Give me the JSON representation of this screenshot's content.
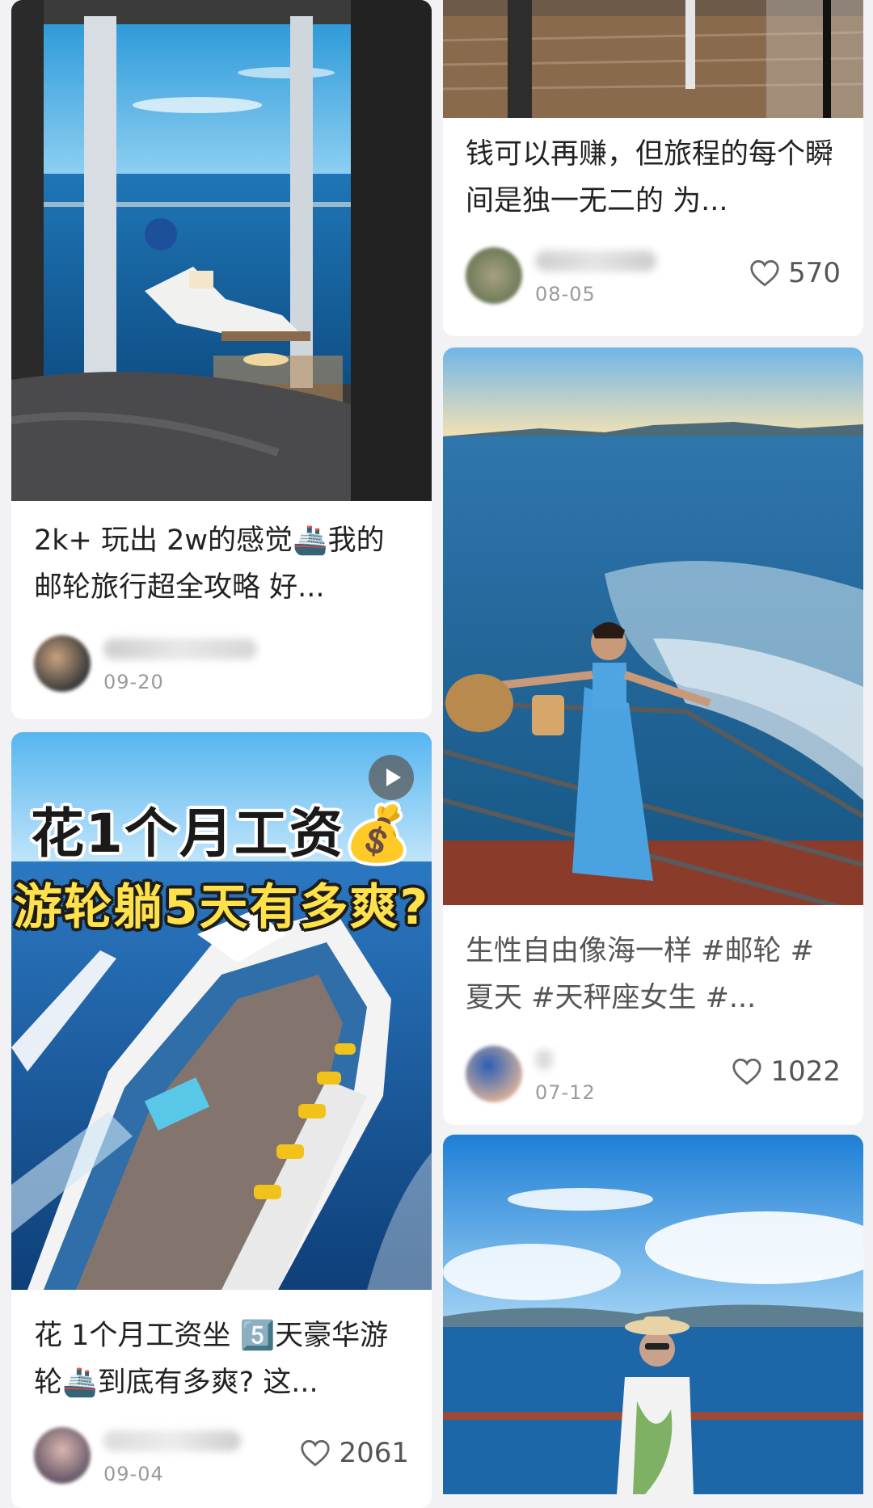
{
  "feed": {
    "left": [
      {
        "title": "2k+ 玩出 2w的感觉🚢我的邮轮旅行超全攻略 好...",
        "date": "09-20",
        "likes": ""
      },
      {
        "overlay_line1": "花1个月工资💰",
        "overlay_line2": "游轮躺5天有多爽?",
        "is_video": true,
        "title": "花 1个月工资坐 5️⃣天豪华游轮🚢到底有多爽? 这...",
        "date": "09-04",
        "likes": "2061"
      }
    ],
    "right": [
      {
        "title": "钱可以再赚，但旅程的每个瞬间是独一无二的 为...",
        "date": "08-05",
        "likes": "570"
      },
      {
        "title": "生性自由像海一样 #邮轮 #夏天 #天秤座女生 #...",
        "date": "07-12",
        "likes": "1022"
      },
      {
        "title": "",
        "date": "",
        "likes": ""
      }
    ]
  },
  "icons": {
    "like": "heart-outline-icon",
    "video": "play-icon"
  },
  "colors": {
    "background": "#f2f2f4",
    "card": "#ffffff",
    "text": "#222222",
    "meta": "#9a9a9a",
    "sea": "#1f6fa8",
    "sky": "#4aa7e6"
  }
}
